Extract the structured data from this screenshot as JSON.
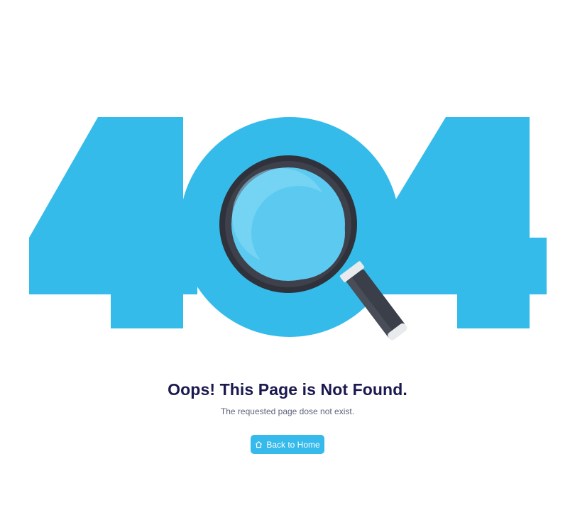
{
  "illustration": {
    "number": "404",
    "icon": "magnifying-glass-icon",
    "colors": {
      "digits": "#35bbea",
      "lens": "#5ccaf0",
      "lens_highlight": "#8bdaf5",
      "frame": "#2f323a",
      "handle": "#3b3f49",
      "collar": "#e8eaed"
    }
  },
  "message": {
    "title": "Oops! This Page is Not Found.",
    "subtitle": "The requested page dose not exist."
  },
  "button": {
    "label": "Back to Home",
    "icon": "home-icon",
    "color": "#36b9eb"
  }
}
